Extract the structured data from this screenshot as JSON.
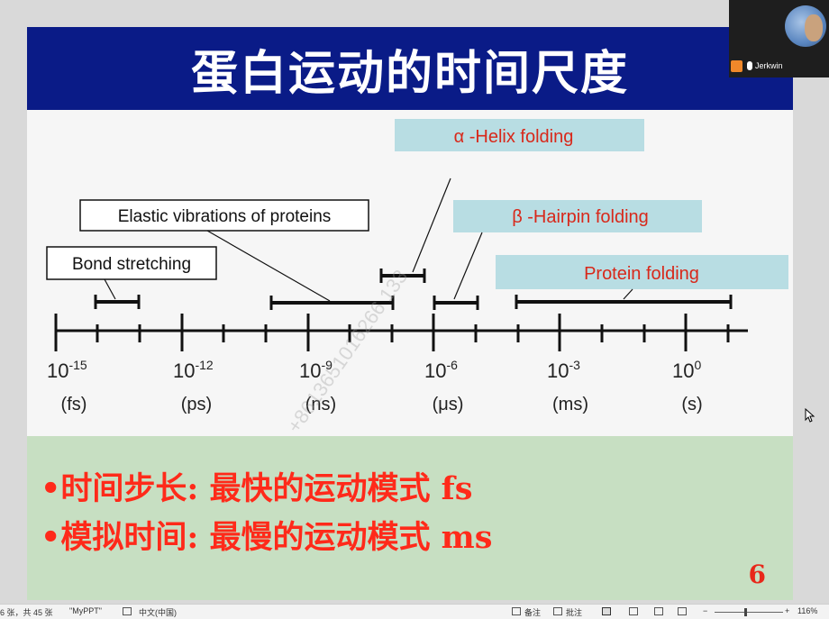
{
  "slide": {
    "title": "蛋白运动的时间尺度",
    "bullets": [
      "•时间步长: 最快的运动模式 fs",
      "•模拟时间: 最慢的运动模式 ms"
    ],
    "page_number": "6",
    "timeline": {
      "callouts": {
        "alpha_helix": "α -Helix folding",
        "beta_hairpin": "β -Hairpin folding",
        "protein_folding": "Protein folding",
        "elastic": "Elastic vibrations of proteins",
        "bond": "Bond stretching"
      },
      "ticks": [
        {
          "base": "10",
          "exp": "-15",
          "unit": "(fs)"
        },
        {
          "base": "10",
          "exp": "-12",
          "unit": "(ps)"
        },
        {
          "base": "10",
          "exp": "-9",
          "unit": "(ns)"
        },
        {
          "base": "10",
          "exp": "-6",
          "unit": "(μs)"
        },
        {
          "base": "10",
          "exp": "-3",
          "unit": "(ms)"
        },
        {
          "base": "10",
          "exp": "0",
          "unit": "(s)"
        }
      ],
      "watermark": "+8613651016266 133"
    },
    "colors": {
      "title_bg": "#0a1b87",
      "callout_bg": "#b8dde3",
      "bullet_text": "#ff2a1a",
      "lower_bg": "#c7dfc2"
    }
  },
  "webcam": {
    "name": "Jerkwin"
  },
  "status_bar": {
    "slide_info": "6 张，共 45 张",
    "theme": "\"MyPPT\"",
    "language": "中文(中国)",
    "notes": "备注",
    "comments": "批注",
    "zoom": "116%"
  }
}
